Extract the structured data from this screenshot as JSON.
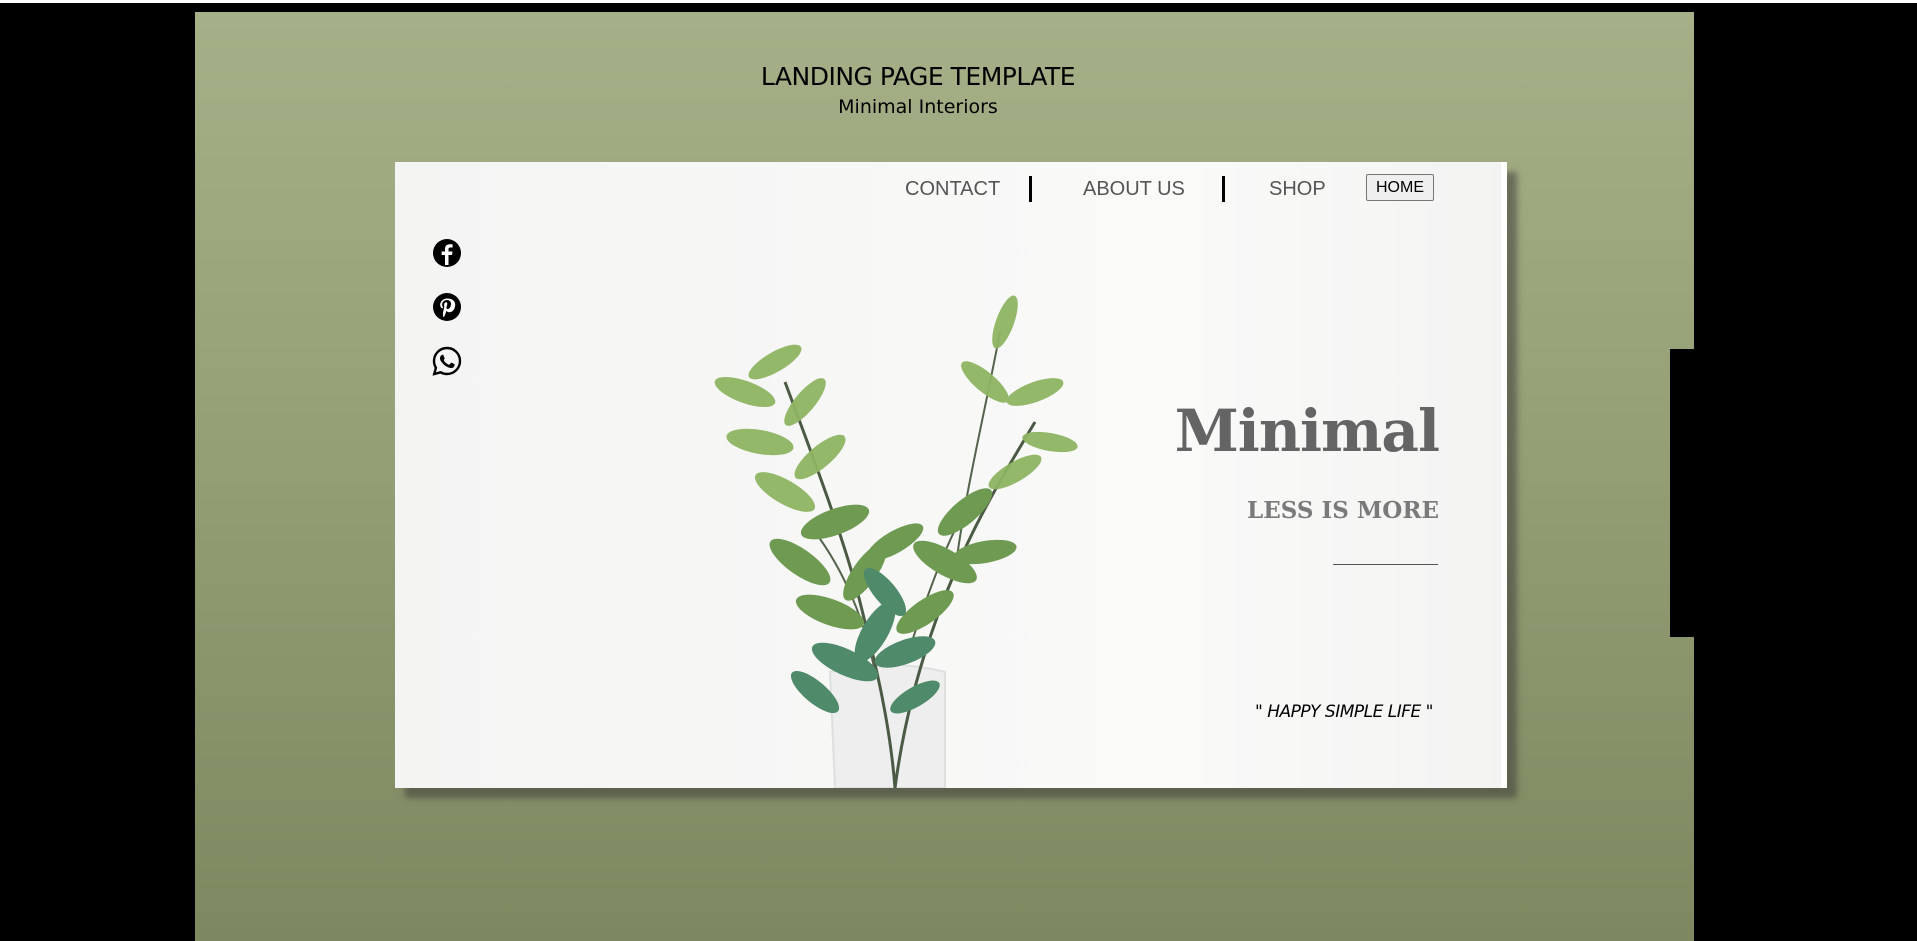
{
  "header": {
    "title": "LANDING PAGE TEMPLATE",
    "subtitle": "Minimal Interiors"
  },
  "nav": {
    "items": [
      {
        "label": "CONTACT"
      },
      {
        "label": "ABOUT US"
      },
      {
        "label": "SHOP"
      }
    ],
    "home_label": "HOME"
  },
  "social": [
    {
      "icon": "facebook-icon"
    },
    {
      "icon": "pinterest-icon"
    },
    {
      "icon": "whatsapp-icon"
    }
  ],
  "hero": {
    "title": "Minimal",
    "subtitle": "LESS IS MORE",
    "quote": "\" HAPPY SIMPLE LIFE \""
  },
  "colors": {
    "background_top": "#a6b088",
    "background_bottom": "#7e8860",
    "hero_title": "#646464",
    "nav_text": "#555555"
  }
}
